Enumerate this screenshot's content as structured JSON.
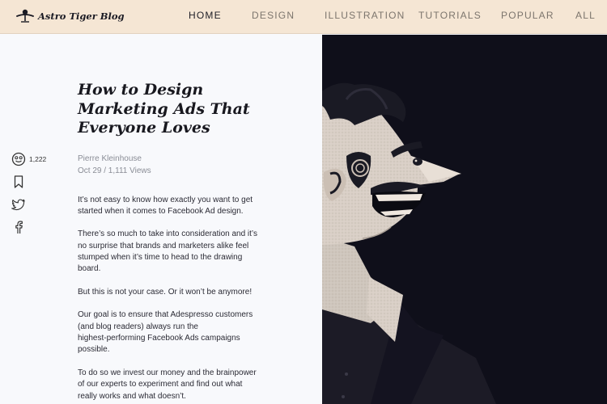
{
  "brand": {
    "name": "Astro Tiger Blog",
    "logo_icon": "bird-logo-icon"
  },
  "nav": {
    "active": "HOME",
    "items": [
      {
        "label": "HOME"
      },
      {
        "label": "DESIGN"
      },
      {
        "label": "ILLUSTRATION"
      },
      {
        "label": "TUTORIALS"
      },
      {
        "label": "POPULAR"
      },
      {
        "label": "ALL"
      }
    ]
  },
  "share": {
    "likes": "1,222",
    "icons": [
      "smiley-icon",
      "bookmark-icon",
      "twitter-icon",
      "facebook-icon"
    ]
  },
  "article": {
    "title_lines": [
      "How to Design",
      "Marketing Ads That",
      "Everyone Loves"
    ],
    "author": "Pierre Kleinhouse",
    "date_views": "Oct 29 / 1,111 Views",
    "paragraphs": [
      [
        "It’s not easy to know how exactly you want to get",
        "started when it comes to Facebook Ad design."
      ],
      [
        "There’s so much to take into consideration and it’s",
        "no surprise that brands and marketers alike feel",
        "stumped when it’s time to head to the drawing",
        "board."
      ],
      [
        "But this is not your case. Or it won’t be anymore!"
      ],
      [
        "Our goal is to ensure that Adespresso customers",
        "(and blog readers) always run the",
        "highest-performing Facebook Ads campaigns",
        "possible."
      ],
      [
        "To do so we invest our money and the brainpower",
        "of our experts to experiment and find out what",
        "really works and what doesn’t."
      ]
    ]
  },
  "colors": {
    "topbar": "#f5e6d4",
    "hero_bg": "#0f0f1a",
    "face": "#d9cfc6",
    "hair": "#1a1a24"
  }
}
